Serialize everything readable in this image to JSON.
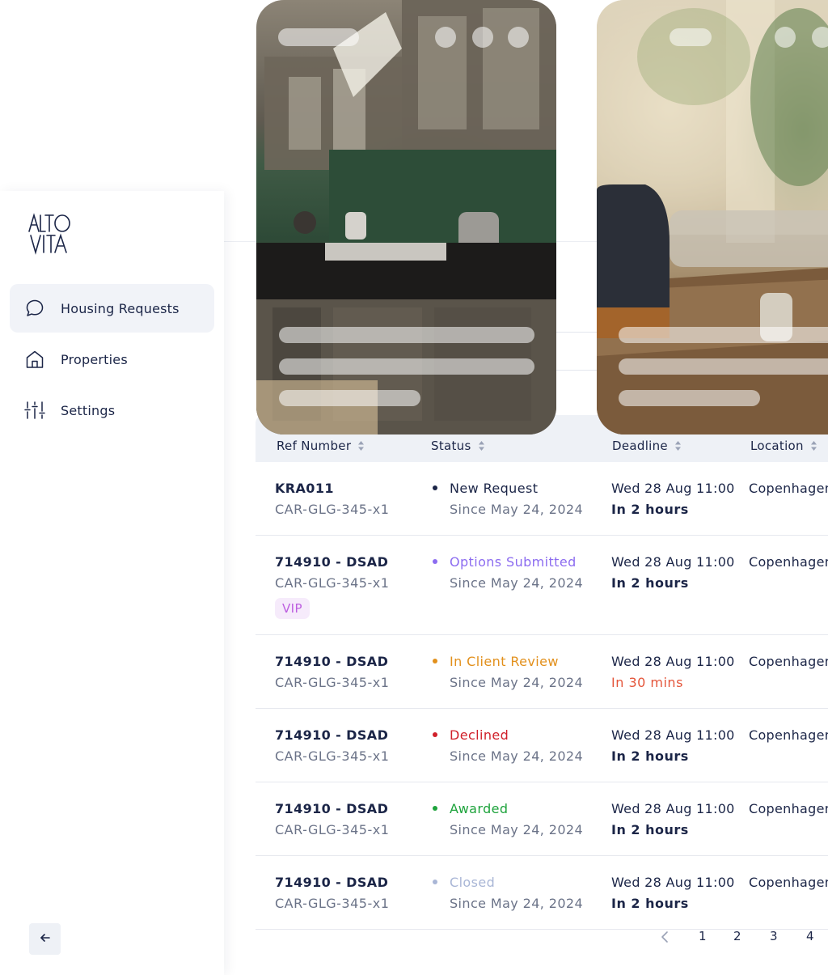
{
  "brand": {
    "logo_text": "ALTO VITA"
  },
  "sidebar": {
    "items": [
      {
        "label": "Housing Requests",
        "icon": "chat-bubble-icon",
        "active": true
      },
      {
        "label": "Properties",
        "icon": "house-icon",
        "active": false
      },
      {
        "label": "Settings",
        "icon": "sliders-icon",
        "active": false
      }
    ],
    "collapse_icon": "arrow-left-icon"
  },
  "table": {
    "columns": [
      "Ref Number",
      "Status",
      "Deadline",
      "Location"
    ],
    "rows": [
      {
        "ref": "KRA011",
        "code": "CAR-GLG-345-x1",
        "vip": "",
        "status": "New Request",
        "status_color": "#1b2547",
        "since": "Since May 24, 2024",
        "deadline": "Wed 28 Aug 11:00",
        "relative": "In 2 hours",
        "relative_color": "#1b2547",
        "location": "Copenhagen"
      },
      {
        "ref": "714910 - DSAD",
        "code": "CAR-GLG-345-x1",
        "vip": "VIP",
        "status": "Options Submitted",
        "status_color": "#8c6cf0",
        "since": "Since May 24, 2024",
        "deadline": "Wed 28 Aug 11:00",
        "relative": "In 2 hours",
        "relative_color": "#1b2547",
        "location": "Copenhagen"
      },
      {
        "ref": "714910 - DSAD",
        "code": "CAR-GLG-345-x1",
        "vip": "",
        "status": "In Client Review",
        "status_color": "#e2901c",
        "since": "Since May 24, 2024",
        "deadline": "Wed 28 Aug 11:00",
        "relative": "In 30 mins",
        "relative_color": "#e4553a",
        "location": "Copenhagen"
      },
      {
        "ref": "714910 - DSAD",
        "code": "CAR-GLG-345-x1",
        "vip": "",
        "status": "Declined",
        "status_color": "#d0202a",
        "since": "Since May 24, 2024",
        "deadline": "Wed 28 Aug 11:00",
        "relative": "In 2 hours",
        "relative_color": "#1b2547",
        "location": "Copenhagen"
      },
      {
        "ref": "714910 - DSAD",
        "code": "CAR-GLG-345-x1",
        "vip": "",
        "status": "Awarded",
        "status_color": "#1ea33c",
        "since": "Since May 24, 2024",
        "deadline": "Wed 28 Aug 11:00",
        "relative": "In 2 hours",
        "relative_color": "#1b2547",
        "location": "Copenhagen"
      },
      {
        "ref": "714910 - DSAD",
        "code": "CAR-GLG-345-x1",
        "vip": "",
        "status": "Closed",
        "status_color": "#a9b6d6",
        "since": "Since May 24, 2024",
        "deadline": "Wed 28 Aug 11:00",
        "relative": "In 2 hours",
        "relative_color": "#1b2547",
        "location": "Copenhagen"
      }
    ]
  },
  "pagination": {
    "prev_icon": "chevron-left-icon",
    "pages": [
      "1",
      "2",
      "3",
      "4"
    ]
  },
  "colors": {
    "text_primary": "#1b2547",
    "text_secondary": "#6b7388",
    "header_bg": "#eef1f6",
    "active_nav_bg": "#f1f3f8"
  }
}
